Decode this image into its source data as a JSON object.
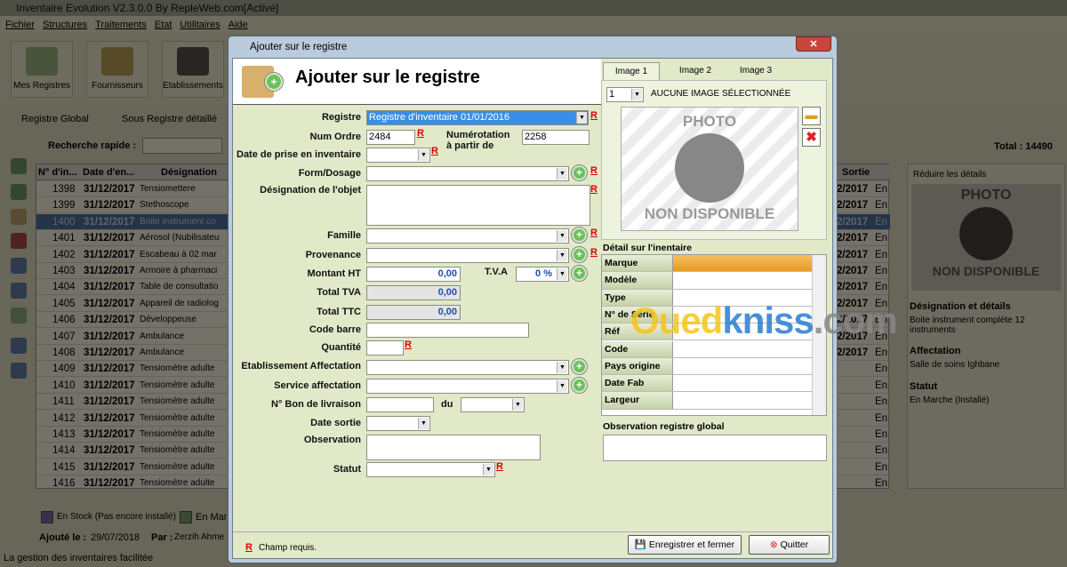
{
  "app": {
    "title": "Inventaire Evolution V2.3.0.0 By RepleWeb.com[Activé]",
    "menu": [
      "Fichier",
      "Structures",
      "Traitements",
      "Etat",
      "Utilitaires",
      "Aide"
    ],
    "ribbon": [
      "Mes Registres",
      "Fournisseurs",
      "Etablissements"
    ],
    "tabs": [
      "Registre Global",
      "Sous Registre détaillé"
    ],
    "search_label": "Recherche rapide :",
    "total": "Total : 14490",
    "columns": [
      "N° d'in...",
      "Date d'en...",
      "Désignation",
      "Sortie"
    ],
    "rows": [
      [
        "1398",
        "31/12/2017",
        "Tensiomettere"
      ],
      [
        "1399",
        "31/12/2017",
        "Stethoscope"
      ],
      [
        "1400",
        "31/12/2017",
        "Boite instrument co"
      ],
      [
        "1401",
        "31/12/2017",
        "Aérosol (Nubilisateu"
      ],
      [
        "1402",
        "31/12/2017",
        "Escabeau à 02 mar"
      ],
      [
        "1403",
        "31/12/2017",
        "Armoire à pharmaci"
      ],
      [
        "1404",
        "31/12/2017",
        "Table de consultatio"
      ],
      [
        "1405",
        "31/12/2017",
        "Appareil de radiolog"
      ],
      [
        "1406",
        "31/12/2017",
        "Développeuse"
      ],
      [
        "1407",
        "31/12/2017",
        "Ambulance"
      ],
      [
        "1408",
        "31/12/2017",
        "Ambulance"
      ],
      [
        "1409",
        "31/12/2017",
        "Tensiomètre adulte"
      ],
      [
        "1410",
        "31/12/2017",
        "Tensiomètre adulte"
      ],
      [
        "1411",
        "31/12/2017",
        "Tensiomètre adulte"
      ],
      [
        "1412",
        "31/12/2017",
        "Tensiomètre adulte"
      ],
      [
        "1413",
        "31/12/2017",
        "Tensiomètre adulte"
      ],
      [
        "1414",
        "31/12/2017",
        "Tensiomètre adulte"
      ],
      [
        "1415",
        "31/12/2017",
        "Tensiomètre adulte"
      ],
      [
        "1416",
        "31/12/2017",
        "Tensiomètre adulte"
      ]
    ],
    "sortie": [
      "2/2017",
      "2/2017",
      "2/2017",
      "2/2017",
      "2/2017",
      "2/2017",
      "2/2017",
      "2/2017",
      "2/2017",
      "2/2017",
      "2/2017",
      "",
      "",
      "",
      "",
      "",
      "",
      "",
      ""
    ],
    "etat": "En",
    "selected_row": 2,
    "legend": [
      "En Stock (Pas encore installé)",
      "En Mar"
    ],
    "added_label": "Ajouté le :",
    "added_date": "29/07/2018",
    "par_label": "Par :",
    "par_value": "Zerzih Ahme",
    "status": "La gestion des inventaires facilitée",
    "detail": {
      "reduce": "Réduire les détails",
      "photo": "PHOTO",
      "non_dispo": "NON DISPONIBLE",
      "designation_title": "Désignation et détails",
      "designation": "Boite instrument complète 12 instruments",
      "affectation_title": "Affectation",
      "affectation": "Salle de soins Ighbane",
      "statut_title": "Statut",
      "statut": "En Marche (Installé)"
    }
  },
  "dialog": {
    "window_title": "Ajouter sur le registre",
    "heading": "Ajouter sur le registre",
    "close": "✕",
    "labels": {
      "registre": "Registre",
      "num_ordre": "Num Ordre",
      "numerotation": "Numérotation à partir de",
      "date_prise": "Date de prise en inventaire",
      "form": "Form/Dosage",
      "designation": "Désignation de l'objet",
      "famille": "Famille",
      "provenance": "Provenance",
      "montant_ht": "Montant HT",
      "tva": "T.V.A",
      "total_tva": "Total TVA",
      "total_ttc": "Total TTC",
      "code_barre": "Code barre",
      "quantite": "Quantité",
      "etab": "Etablissement Affectation",
      "service": "Service affectation",
      "bon": "N° Bon de livraison",
      "du": "du",
      "date_sortie": "Date sortie",
      "observation": "Observation",
      "statut": "Statut"
    },
    "values": {
      "registre": "Registre d'inventaire 01/01/2016",
      "num_ordre": "2484",
      "numerotation": "2258",
      "montant_ht": "0,00",
      "tva": "0 %",
      "total_tva": "0,00",
      "total_ttc": "0,00"
    },
    "req": "R",
    "image_tabs": [
      "Image 1",
      "Image 2",
      "Image 3"
    ],
    "image_index": "1",
    "no_image": "AUCUNE IMAGE SÉLECTIONNÉE",
    "photo": "PHOTO",
    "non_dispo": "NON DISPONIBLE",
    "detail_title": "Détail sur l'inentaire",
    "detail_fields": [
      "Marque",
      "Modèle",
      "Type",
      "N° de Série",
      "Réf",
      "Code",
      "Pays origine",
      "Date Fab",
      "Largeur"
    ],
    "obs_global": "Observation registre global",
    "required_note": "Champ requis.",
    "save": "Enregistrer et fermer",
    "quit": "Quitter"
  },
  "watermark": {
    "a": "Oued",
    "b": "kniss",
    ".com": ".com",
    "c": ".com"
  },
  "colors": {
    "accent": "#3a78c8",
    "form_bg": "#e1e9c9",
    "required": "#dd0000",
    "highlight": "#f0a030"
  }
}
